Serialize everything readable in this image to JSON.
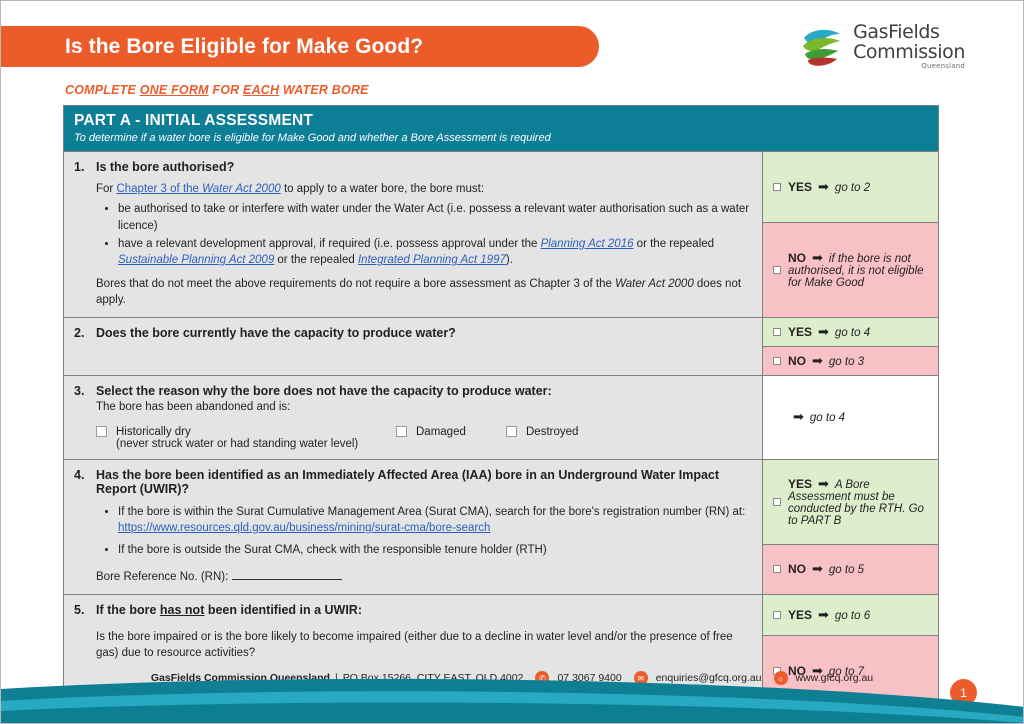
{
  "header": {
    "title": "Is the Bore Eligible for Make Good?",
    "subtitle_parts": [
      "COMPLETE ",
      "ONE FORM",
      " FOR ",
      "EACH",
      " WATER BORE"
    ],
    "accent_orange": "#ec5c2b",
    "accent_teal": "#0c7e96"
  },
  "logo": {
    "line1": "GasFields",
    "line2": "Commission",
    "line3": "Queensland"
  },
  "part": {
    "heading": "PART A - INITIAL ASSESSMENT",
    "subheading": "To determine if a water bore is eligible for Make Good and whether a Bore Assessment is required"
  },
  "questions": [
    {
      "num": "1.",
      "title": "Is the bore authorised?",
      "intro_pre": "For ",
      "intro_link": "Chapter 3 of the ",
      "intro_link_it": "Water Act 2000",
      "intro_post": " to apply to a water bore, the bore must:",
      "bullets": [
        {
          "text": "be authorised to take or interfere with water under the Water Act (i.e. possess a relevant water authorisation such as a water licence)"
        },
        {
          "pre": "have a relevant development approval, if required (i.e. possess approval under the ",
          "link1": "Planning Act 2016",
          "mid1": " or the repealed ",
          "link2": "Sustainable Planning Act 2009",
          "mid2": " or the repealed ",
          "link3": "Integrated Planning Act 1997",
          "post": ")."
        }
      ],
      "closing_pre": "Bores that do not meet the above requirements do not require a bore assessment as Chapter 3 of the ",
      "closing_it": "Water Act 2000",
      "closing_post": " does not apply."
    },
    {
      "num": "2.",
      "title": "Does the bore currently have the capacity to produce water?"
    },
    {
      "num": "3.",
      "title": "Select the reason why the bore does not have the capacity to produce water:",
      "sub": "The bore has been abandoned and is:",
      "options": [
        {
          "label": "Historically dry",
          "sublabel": "(never struck water or had standing water level)"
        },
        {
          "label": "Damaged",
          "sublabel": ""
        },
        {
          "label": "Destroyed",
          "sublabel": ""
        }
      ]
    },
    {
      "num": "4.",
      "title": "Has the bore been identified as an Immediately Affected Area (IAA) bore in an Underground Water Impact Report (UWIR)?",
      "bullet1_pre": "If the bore is within the Surat Cumulative Management Area (Surat CMA), search for the bore's registration number (RN) at:",
      "bullet1_link": "https://www.resources.qld.gov.au/business/mining/surat-cma/bore-search",
      "bullet2": "If the bore is outside the Surat CMA, check with the responsible tenure holder (RTH)",
      "rn_label": "Bore Reference No. (RN):",
      "rn_value": ""
    },
    {
      "num": "5.",
      "title_pre": "If the bore ",
      "title_u": "has not",
      "title_post": " been identified in a UWIR:",
      "body": "Is the bore impaired or is the bore likely to become impaired (either due to a decline in water level and/or the presence of free gas) due to resource activities?"
    }
  ],
  "answers": [
    {
      "type": "yes",
      "label": "YES",
      "arrow": "➡",
      "note": "go to 2"
    },
    {
      "type": "no",
      "label": "NO",
      "arrow": "➡",
      "note": "if the bore is not authorised, it is not eligible for Make Good"
    },
    {
      "type": "yes",
      "label": "YES",
      "arrow": "➡",
      "note": "go to 4"
    },
    {
      "type": "no",
      "label": "NO",
      "arrow": "➡",
      "note": "go to 3"
    },
    {
      "type": "plain",
      "label": "",
      "arrow": "➡",
      "note": "go to 4"
    },
    {
      "type": "yes",
      "label": "YES",
      "arrow": "➡",
      "note": "A Bore Assessment must be conducted by the RTH. Go to PART B"
    },
    {
      "type": "no",
      "label": "NO",
      "arrow": "➡",
      "note": "go to 5"
    },
    {
      "type": "yes",
      "label": "YES",
      "arrow": "➡",
      "note": "go to 6"
    },
    {
      "type": "no",
      "label": "NO",
      "arrow": "➡",
      "note": "go to 7"
    }
  ],
  "footer": {
    "org": "GasFields Commission Queensland",
    "separator": "|",
    "address": "PO Box 15266, CITY EAST, QLD 4002",
    "phone": "07 3067 9400",
    "email": "enquiries@gfcq.org.au",
    "website": "www.gfcq.org.au",
    "page_number": "1"
  }
}
